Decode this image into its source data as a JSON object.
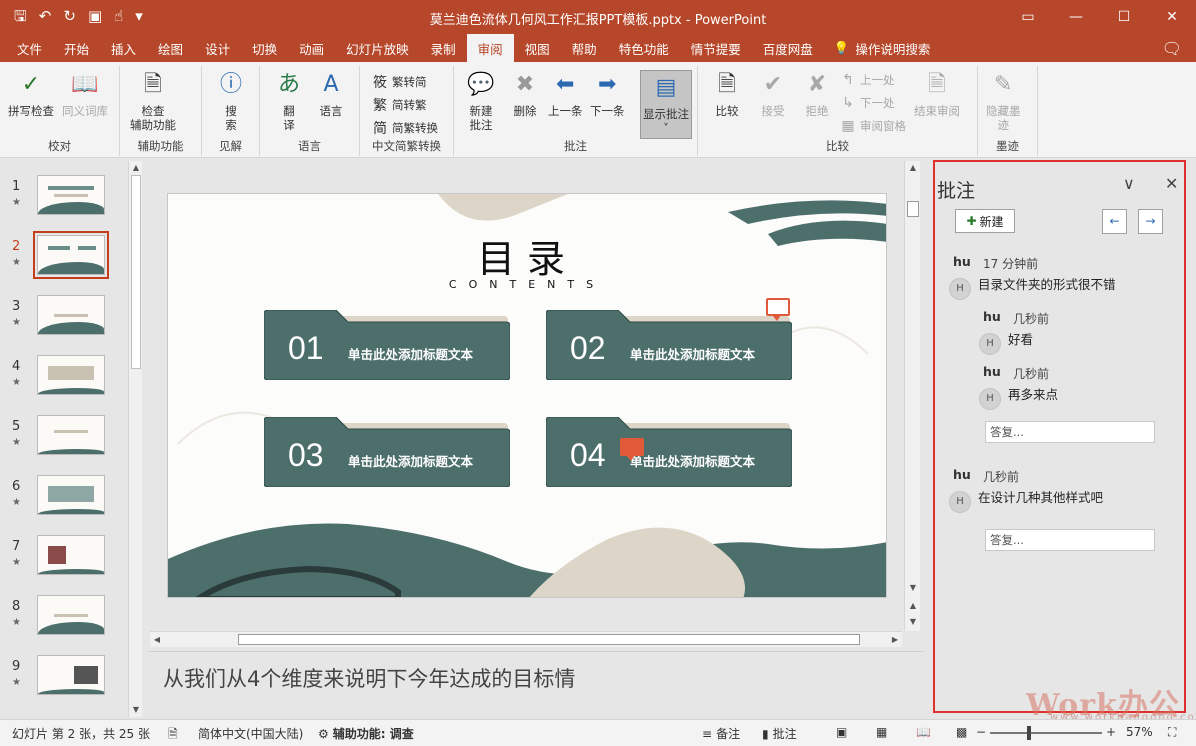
{
  "titlebar": {
    "title": "莫兰迪色流体几何风工作汇报PPT模板.pptx  -  PowerPoint",
    "qat": [
      "save-icon",
      "undo-icon",
      "redo-icon",
      "present-icon",
      "touch-icon",
      "customize-icon"
    ]
  },
  "tabs": [
    "文件",
    "开始",
    "插入",
    "绘图",
    "设计",
    "切换",
    "动画",
    "幻灯片放映",
    "录制",
    "审阅",
    "视图",
    "帮助",
    "特色功能",
    "情节提要",
    "百度网盘"
  ],
  "active_tab": "审阅",
  "tell_me": "操作说明搜索",
  "ribbon": {
    "proofing": {
      "label": "校对",
      "spelling": "拼写检查",
      "thesaurus": "同义词库"
    },
    "accessibility": {
      "label": "辅助功能",
      "check_line1": "检查",
      "check_line2": "辅助功能"
    },
    "insights": {
      "label": "见解",
      "search_line1": "搜",
      "search_line2": "索"
    },
    "language": {
      "label": "语言",
      "translate_line1": "翻",
      "translate_line2": "译",
      "language": "语言"
    },
    "chinese": {
      "label": "中文简繁转换",
      "t2s": "繁转简",
      "s2t": "简转繁",
      "convert": "简繁转换"
    },
    "comments": {
      "label": "批注",
      "new_line1": "新建",
      "new_line2": "批注",
      "delete": "删除",
      "previous": "上一条",
      "next": "下一条",
      "show": "显示批注"
    },
    "compare": {
      "label": "比较",
      "compare": "比较",
      "accept": "接受",
      "reject": "拒绝",
      "prev": "上一处",
      "next": "下一处",
      "pane": "审阅窗格",
      "end": "结束审阅"
    },
    "ink": {
      "label": "墨迹",
      "hide_line1": "隐藏墨",
      "hide_line2": "迹"
    }
  },
  "thumbnails": [
    {
      "num": "1",
      "star": "★"
    },
    {
      "num": "2",
      "star": "★"
    },
    {
      "num": "3",
      "star": "★"
    },
    {
      "num": "4",
      "star": "★"
    },
    {
      "num": "5",
      "star": "★"
    },
    {
      "num": "6",
      "star": "★"
    },
    {
      "num": "7",
      "star": "★"
    },
    {
      "num": "8",
      "star": "★"
    },
    {
      "num": "9",
      "star": "★"
    }
  ],
  "active_slide": 2,
  "slide": {
    "title": "目录",
    "subtitle": "CONTENTS",
    "cards": [
      {
        "num": "01",
        "label": "单击此处添加标题文本"
      },
      {
        "num": "02",
        "label": "单击此处添加标题文本"
      },
      {
        "num": "03",
        "label": "单击此处添加标题文本"
      },
      {
        "num": "04",
        "label": "单击此处添加标题文本"
      }
    ]
  },
  "notes": "从我们从4个维度来说明下今年达成的目标情",
  "comments_pane": {
    "title": "批注",
    "new_button": "新建",
    "threads": [
      {
        "author": "hu",
        "time": "17 分钟前",
        "initial": "H",
        "text": "目录文件夹的形式很不错",
        "replies": [
          {
            "author": "hu",
            "time": "几秒前",
            "initial": "H",
            "text": "好看"
          },
          {
            "author": "hu",
            "time": "几秒前",
            "initial": "H",
            "text": "再多来点"
          }
        ],
        "reply_placeholder": "答复..."
      },
      {
        "author": "hu",
        "time": "几秒前",
        "initial": "H",
        "text": "在设计几种其他样式吧",
        "replies": [],
        "reply_placeholder": "答复..."
      }
    ]
  },
  "statusbar": {
    "slide_info": "幻灯片 第 2 张，共 25 张",
    "language": "简体中文(中国大陆)",
    "accessibility": "辅助功能: 调查",
    "notes": "备注",
    "comments": "批注",
    "zoom": "57%"
  },
  "watermark": {
    "text": "Work办公",
    "url": "www.workbangong.com"
  },
  "colors": {
    "accent": "#b7472a",
    "slide_teal": "#4c6f6c",
    "slide_beige": "#ddd6c8",
    "comment_mark": "#e05a39",
    "pane_border": "#e0302b"
  }
}
